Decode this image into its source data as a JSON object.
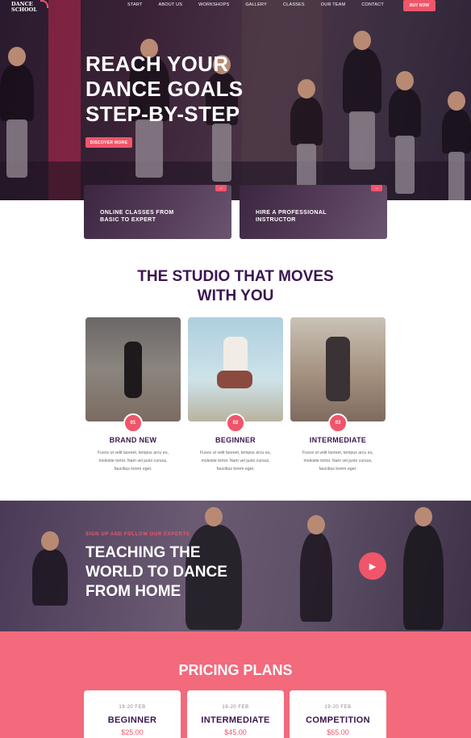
{
  "nav": {
    "logo_line1": "DANCE",
    "logo_line2": "SCHOOL",
    "links": [
      "START",
      "ABOUT US",
      "WORKSHOPS",
      "GALLERY",
      "CLASSES",
      "OUR TEAM",
      "CONTACT"
    ],
    "buy_label": "BUY NOW"
  },
  "hero": {
    "title_line1": "REACH YOUR",
    "title_line2": "DANCE GOALS",
    "title_line3": "STEP-BY-STEP",
    "discover_label": "DISCOVER MORE"
  },
  "features": [
    {
      "line1": "ONLINE CLASSES FROM",
      "line2": "BASIC TO EXPERT",
      "arrow": "→"
    },
    {
      "line1": "HIRE A PROFESSIONAL",
      "line2": "INSTRUCTOR",
      "arrow": "→"
    }
  ],
  "studio": {
    "title_line1": "THE STUDIO THAT MOVES",
    "title_line2": "WITH YOU",
    "classes": [
      {
        "number": "01",
        "name": "BRAND NEW",
        "desc1": "Fusce ut velit laoreet, tempus arcu eu,",
        "desc2": "molestie tortor. Nam vel justo cursus,",
        "desc3": "faucibus lorem eget."
      },
      {
        "number": "02",
        "name": "BEGINNER",
        "desc1": "Fusce ut velit laoreet, tempus arcu eu,",
        "desc2": "molestie tortor. Nam vel justo cursus,",
        "desc3": "faucibus lorem eget."
      },
      {
        "number": "03",
        "name": "INTERMEDIATE",
        "desc1": "Fusce ut velit laoreet, tempus arcu eu,",
        "desc2": "molestie tortor. Nam vel justo cursus,",
        "desc3": "faucibus lorem eget."
      }
    ]
  },
  "teaching": {
    "subtitle": "SIGN UP AND FOLLOW OUR EXPERTS",
    "title_line1": "TEACHING THE",
    "title_line2": "WORLD TO DANCE",
    "title_line3": "FROM HOME",
    "play_icon": "play-icon"
  },
  "pricing": {
    "title": "PRICING PLANS",
    "plans": [
      {
        "date": "19-20 FEB",
        "name": "BEGINNER",
        "price": "$25.00"
      },
      {
        "date": "19-20 FEB",
        "name": "INTERMEDIATE",
        "price": "$45.00"
      },
      {
        "date": "19-20 FEB",
        "name": "COMPETITION",
        "price": "$65.00"
      }
    ]
  },
  "colors": {
    "accent": "#f0556a",
    "heading": "#3b1550",
    "pricing_bg": "#f26a7c"
  }
}
